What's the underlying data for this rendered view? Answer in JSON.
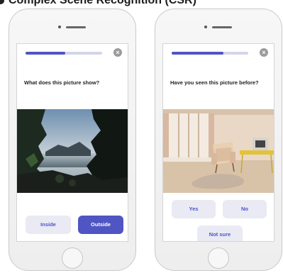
{
  "heading": "Complex Scene Recognition (CSR)",
  "phones": [
    {
      "progress": 0.52,
      "question": "What does this picture show?",
      "buttons": [
        "Inside",
        "Outside"
      ],
      "photo_icon": "coastal-landscape-photo"
    },
    {
      "progress": 0.68,
      "question": "Have you seen this picture before?",
      "buttons": [
        "Yes",
        "No",
        "Not sure"
      ],
      "photo_icon": "living-room-photo"
    }
  ],
  "close_glyph": "×",
  "colors": {
    "accent": "#4f55c3",
    "accent_light": "#e9eaf4",
    "track": "#d3d6ea"
  }
}
